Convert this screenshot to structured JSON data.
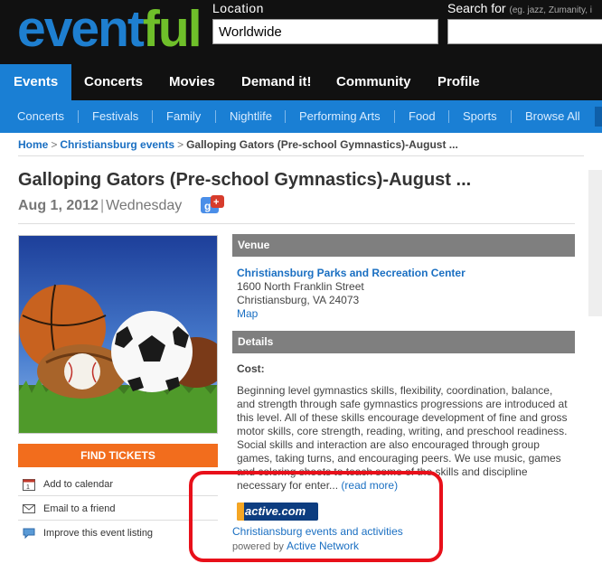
{
  "header": {
    "logo_part1": "event",
    "logo_part2": "ful",
    "location_label": "Location",
    "location_value": "Worldwide",
    "search_label": "Search for",
    "search_hint": "(eg. jazz, Zumanity, i"
  },
  "main_nav": [
    "Events",
    "Concerts",
    "Movies",
    "Demand it!",
    "Community",
    "Profile"
  ],
  "sub_nav": [
    "Concerts",
    "Festivals",
    "Family",
    "Nightlife",
    "Performing Arts",
    "Food",
    "Sports",
    "Browse All"
  ],
  "breadcrumb": {
    "home": "Home",
    "city": "Christiansburg events",
    "current": "Galloping Gators (Pre-school Gymnastics)-August ..."
  },
  "event": {
    "title": "Galloping Gators (Pre-school Gymnastics)-August ...",
    "date": "Aug 1, 2012",
    "weekday": "Wednesday"
  },
  "actions": {
    "find_tickets": "FIND TICKETS",
    "add_calendar": "Add to calendar",
    "email_friend": "Email to a friend",
    "improve": "Improve this event listing"
  },
  "venue": {
    "heading": "Venue",
    "name": "Christiansburg Parks and Recreation Center",
    "street": "1600 North Franklin Street",
    "city_state": "Christiansburg, VA 24073",
    "map": "Map"
  },
  "details": {
    "heading": "Details",
    "cost_label": "Cost:",
    "description": "Beginning level gymnastics skills, flexibility, coordination, balance, and strength through safe gymnastics progressions are introduced at this level.  All of these skills encourage development of fine and gross motor skills, core strength, reading, writing, and preschool readiness.  Social skills and interaction are also encouraged through group games, taking turns, and encouraging peers.  We use music, games and coloring sheets to teach some of the skills and discipline necessary for enter...",
    "read_more": "(read more)"
  },
  "partner": {
    "logo_text": "active.com",
    "link": "Christiansburg events and activities",
    "powered_by": "powered by",
    "network": "Active Network"
  },
  "colors": {
    "brand_blue": "#1a7fd4",
    "cta_orange": "#f26d1d",
    "highlight_red": "#e8101a"
  }
}
